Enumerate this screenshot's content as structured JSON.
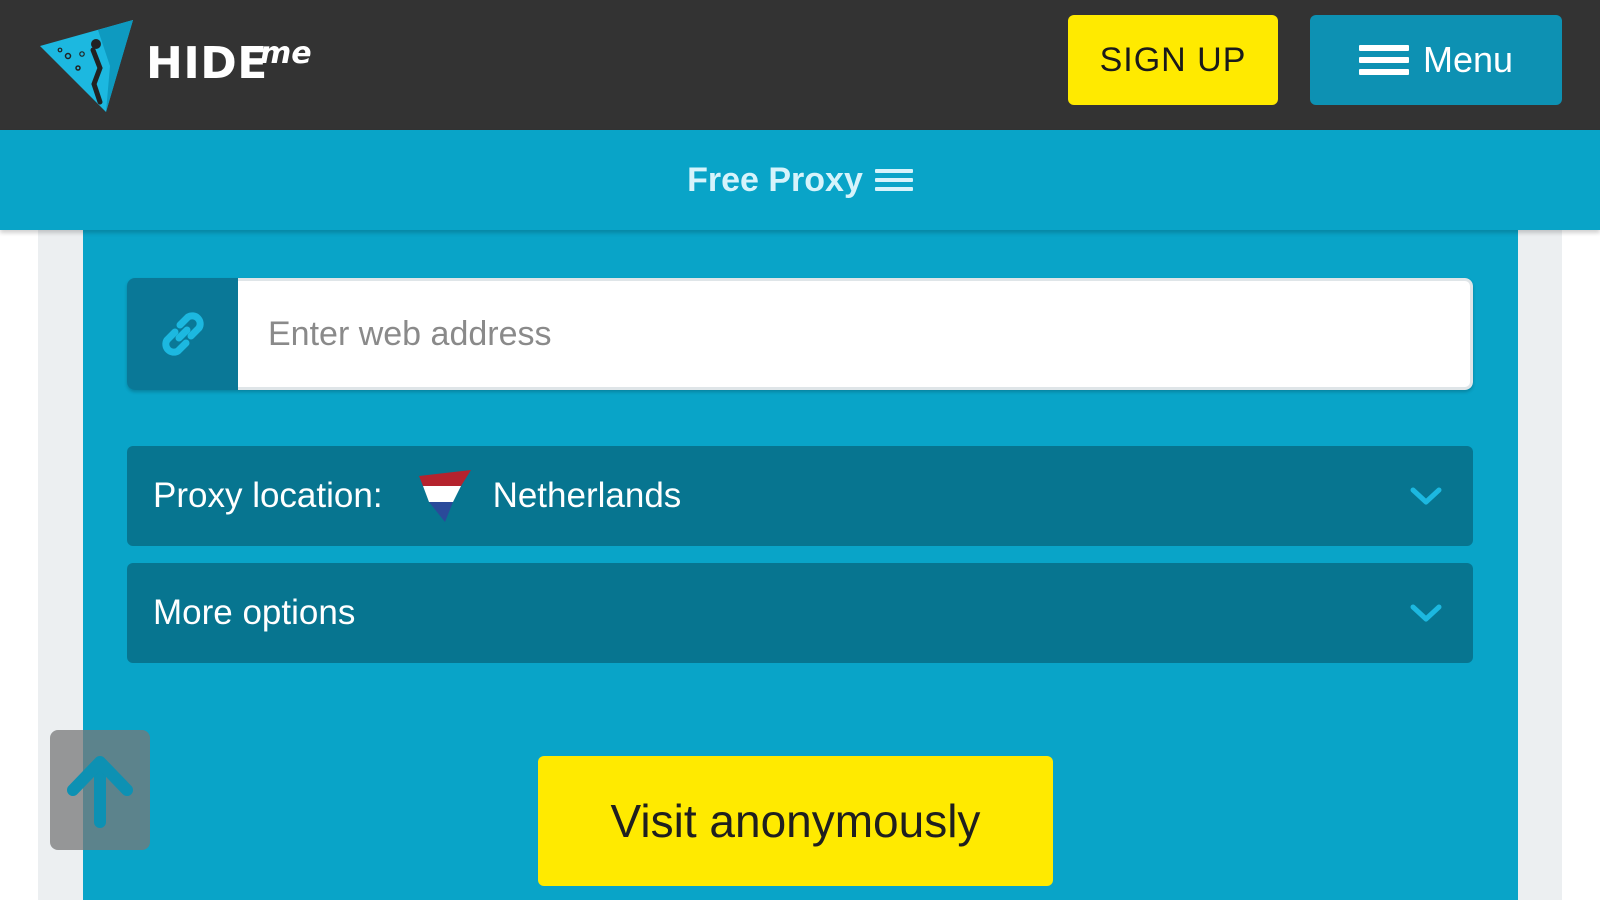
{
  "header": {
    "logo_text": "HIDE",
    "logo_suffix": "me",
    "signup_label": "SIGN UP",
    "menu_label": "Menu"
  },
  "subnav": {
    "title": "Free Proxy"
  },
  "url_field": {
    "placeholder": "Enter web address",
    "value": ""
  },
  "proxy_location": {
    "label": "Proxy location:",
    "selected": "Netherlands",
    "flag_icon": "netherlands-flag-icon"
  },
  "more_options": {
    "label": "More options"
  },
  "visit_button": {
    "label": "Visit anonymously"
  },
  "icons": {
    "logo": "hide-me-logo-icon",
    "link": "link-icon",
    "chevron": "chevron-down-icon",
    "back_to_top": "arrow-up-icon",
    "menu": "hamburger-icon"
  },
  "colors": {
    "header_bg": "#333333",
    "brand_blue": "#09a4c8",
    "dark_blue": "#077590",
    "yellow": "#ffea00"
  }
}
